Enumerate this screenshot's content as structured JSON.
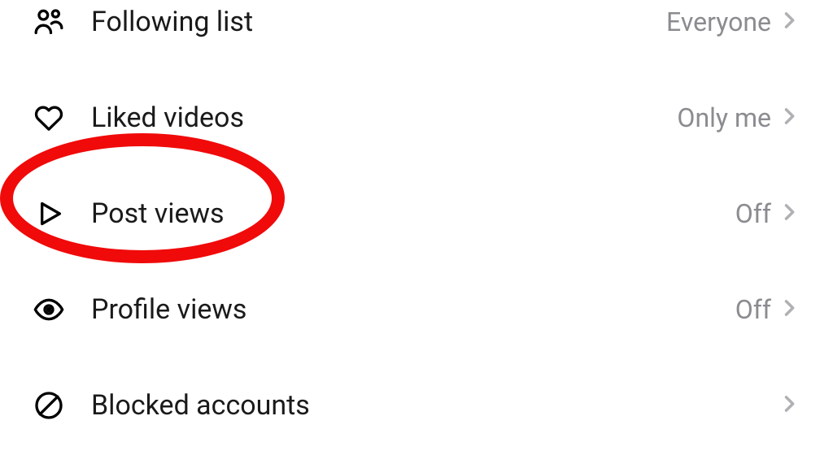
{
  "settings": {
    "items": [
      {
        "label": "Following list",
        "value": "Everyone"
      },
      {
        "label": "Liked videos",
        "value": "Only me"
      },
      {
        "label": "Post views",
        "value": "Off"
      },
      {
        "label": "Profile views",
        "value": "Off"
      },
      {
        "label": "Blocked accounts",
        "value": ""
      }
    ]
  },
  "highlight": {
    "target": "post-views"
  }
}
